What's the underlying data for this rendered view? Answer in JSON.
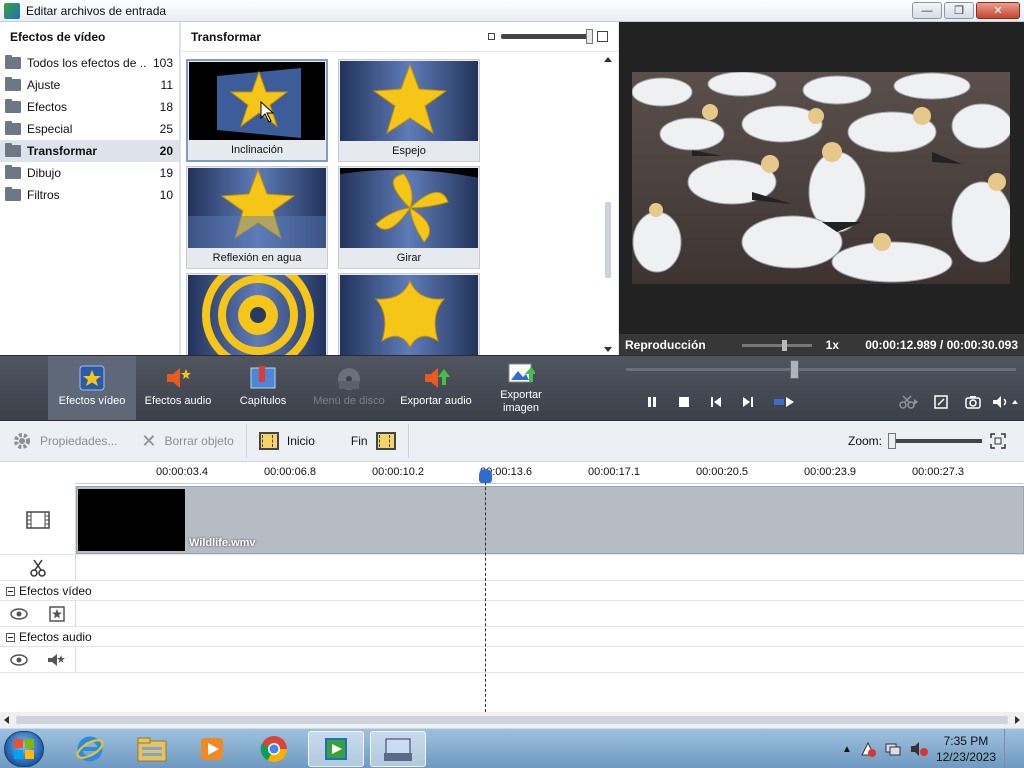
{
  "window": {
    "title": "Editar archivos de entrada"
  },
  "sidebar": {
    "header": "Efectos de vídeo",
    "items": [
      {
        "label": "Todos los efectos de ...",
        "count": "103"
      },
      {
        "label": "Ajuste",
        "count": "11"
      },
      {
        "label": "Efectos",
        "count": "18"
      },
      {
        "label": "Especial",
        "count": "25"
      },
      {
        "label": "Transformar",
        "count": "20"
      },
      {
        "label": "Dibujo",
        "count": "19"
      },
      {
        "label": "Filtros",
        "count": "10"
      }
    ],
    "selected": "Transformar"
  },
  "gallery": {
    "header": "Transformar",
    "tiles": [
      {
        "label": "Inclinación"
      },
      {
        "label": "Espejo"
      },
      {
        "label": "Reflexión en agua"
      },
      {
        "label": "Girar"
      },
      {
        "label": ""
      },
      {
        "label": ""
      }
    ]
  },
  "preview": {
    "mode": "Reproducción",
    "speed": "1x",
    "time": "00:00:12.989 / 00:00:30.093"
  },
  "toolbar": {
    "buttons": [
      {
        "label": "Efectos vídeo",
        "icon": "star-icon"
      },
      {
        "label": "Efectos audio",
        "icon": "speaker-star-icon"
      },
      {
        "label": "Capítulos",
        "icon": "chapters-icon"
      },
      {
        "label": "Menú de disco",
        "icon": "disc-menu-icon"
      },
      {
        "label": "Exportar audio",
        "icon": "export-audio-icon"
      },
      {
        "label": "Exportar imagen",
        "icon": "export-image-icon"
      }
    ]
  },
  "propbar": {
    "properties": "Propiedades...",
    "delete": "Borrar objeto",
    "start": "Inicio",
    "end": "Fin",
    "zoom": "Zoom:"
  },
  "timeline": {
    "ticks": [
      "00:00:03.4",
      "00:00:06.8",
      "00:00:10.2",
      "00:00:13.6",
      "00:00:17.1",
      "00:00:20.5",
      "00:00:23.9",
      "00:00:27.3"
    ],
    "clip_name": "Wildlife.wmv",
    "video_effects_label": "Efectos vídeo",
    "audio_effects_label": "Efectos audio"
  },
  "taskbar": {
    "time": "7:35 PM",
    "date": "12/23/2023"
  },
  "colors": {
    "toolbar_bg": "#454a54",
    "accent_blue": "#2f6bd0",
    "star_yellow": "#f5c518"
  }
}
